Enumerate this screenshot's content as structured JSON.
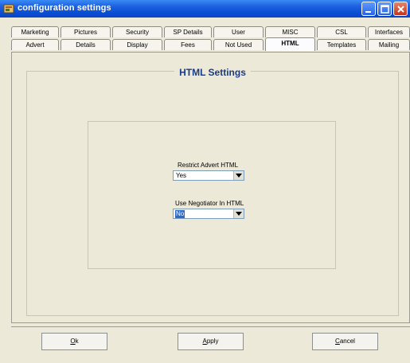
{
  "window": {
    "title": "configuration settings"
  },
  "tabs": {
    "row_back": [
      "Marketing",
      "Pictures",
      "Security",
      "SP Details",
      "User",
      "MISC",
      "CSL",
      "Interfaces"
    ],
    "row_front": [
      "Advert",
      "Details",
      "Display",
      "Fees",
      "Not Used",
      "HTML",
      "Templates",
      "Mailing"
    ],
    "active": "HTML"
  },
  "panel": {
    "title": "HTML Settings",
    "restrict_label": "Restrict Advert HTML",
    "restrict_value": "Yes",
    "negotiator_label": "Use Negotiator In HTML",
    "negotiator_value": "No"
  },
  "buttons": {
    "ok_mnemonic": "O",
    "ok_rest": "k",
    "apply_mnemonic": "A",
    "apply_rest": "pply",
    "cancel_mnemonic": "C",
    "cancel_rest": "ancel"
  },
  "icons": {
    "app": "app-icon",
    "minimize": "minimize-icon",
    "maximize": "maximize-icon",
    "close": "close-icon",
    "dropdown": "chevron-down-icon"
  },
  "colors": {
    "titlebar": "#0A4FD6",
    "window_bg": "#ECE9D8",
    "panel_title": "#1B3C84",
    "selection": "#316AC5"
  }
}
